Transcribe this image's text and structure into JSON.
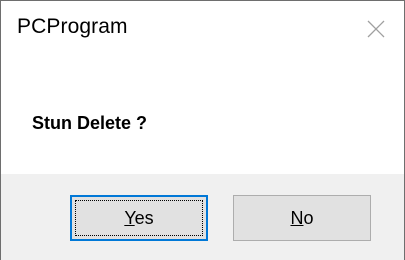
{
  "window": {
    "title": "PCProgram",
    "close_icon": "close-icon"
  },
  "message": {
    "text": "Stun Delete ?"
  },
  "buttons": {
    "yes": {
      "mnemonic": "Y",
      "rest": "es"
    },
    "no": {
      "mnemonic": "N",
      "rest": "o"
    }
  },
  "colors": {
    "accent": "#0078d7",
    "button_face": "#e1e1e1",
    "button_area": "#f0f0f0"
  }
}
